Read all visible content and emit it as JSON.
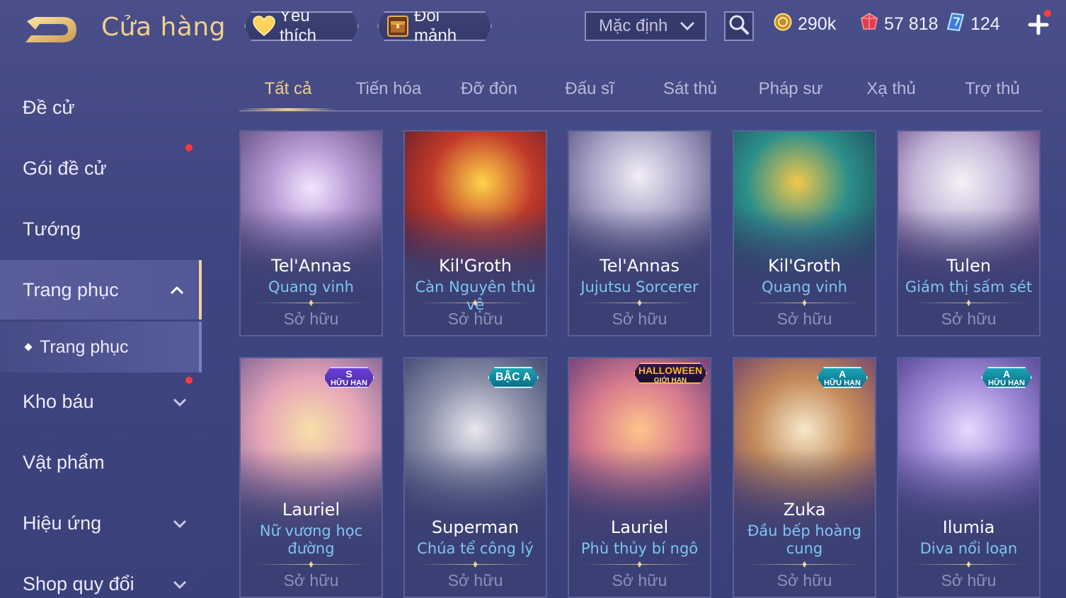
{
  "header": {
    "title": "Cửa hàng",
    "favorite_label": "Yêu thích",
    "exchange_label": "Đổi mảnh",
    "sort_value": "Mặc định",
    "currencies": {
      "gold": "290k",
      "ruby": "57 818",
      "voucher": "124"
    }
  },
  "sidebar": {
    "items": [
      {
        "label": "Đề cử"
      },
      {
        "label": "Gói đề cử"
      },
      {
        "label": "Tướng"
      },
      {
        "label": "Trang phục"
      },
      {
        "label": "Kho báu"
      },
      {
        "label": "Vật phẩm"
      },
      {
        "label": "Hiệu ứng"
      },
      {
        "label": "Shop quy đổi"
      }
    ],
    "sub_item": "Trang phục"
  },
  "tabs": [
    {
      "label": "Tất cả"
    },
    {
      "label": "Tiến hóa"
    },
    {
      "label": "Đỡ đòn"
    },
    {
      "label": "Đấu sĩ"
    },
    {
      "label": "Sát thủ"
    },
    {
      "label": "Pháp sư"
    },
    {
      "label": "Xạ thủ"
    },
    {
      "label": "Trợ thủ"
    }
  ],
  "cards": [
    {
      "hero": "Tel'Annas",
      "skin": "Quang vinh",
      "status": "Sở hữu"
    },
    {
      "hero": "Kil'Groth",
      "skin": "Càn Nguyên thủ vệ",
      "status": "Sở hữu"
    },
    {
      "hero": "Tel'Annas",
      "skin": "Jujutsu Sorcerer",
      "status": "Sở hữu"
    },
    {
      "hero": "Kil'Groth",
      "skin": "Quang vinh",
      "status": "Sở hữu"
    },
    {
      "hero": "Tulen",
      "skin": "Giám thị sấm sét",
      "status": "Sở hữu"
    },
    {
      "hero": "Lauriel",
      "skin": "Nữ vương học đường",
      "status": "Sở hữu",
      "badge_tier": "S",
      "badge_text": "HỮU HẠN"
    },
    {
      "hero": "Superman",
      "skin": "Chúa tể công lý",
      "status": "Sở hữu",
      "badge_text": "BẬC A"
    },
    {
      "hero": "Lauriel",
      "skin": "Phù thủy bí ngô",
      "status": "Sở hữu",
      "badge_tier": "HALLOWEEN",
      "badge_text": "GIỚI HẠN"
    },
    {
      "hero": "Zuka",
      "skin": "Đầu bếp hoàng cung",
      "status": "Sở hữu",
      "badge_tier": "A",
      "badge_text": "HỮU HẠN"
    },
    {
      "hero": "Ilumia",
      "skin": "Diva nổi loạn",
      "status": "Sở hữu",
      "badge_tier": "A",
      "badge_text": "HỮU HẠN"
    }
  ],
  "colors": {
    "background": "#434985",
    "accent_gold": "#f1cf8b",
    "skin_blue": "#7fc4f2",
    "notification_red": "#ff3b3b"
  },
  "icons": [
    "back-arrow-icon",
    "heart-icon",
    "chest-icon",
    "chevron-down-icon",
    "search-icon",
    "gold-coin-icon",
    "ruby-gem-icon",
    "voucher-icon",
    "plus-icon",
    "chevron-up-icon",
    "diamond-bullet-icon"
  ]
}
